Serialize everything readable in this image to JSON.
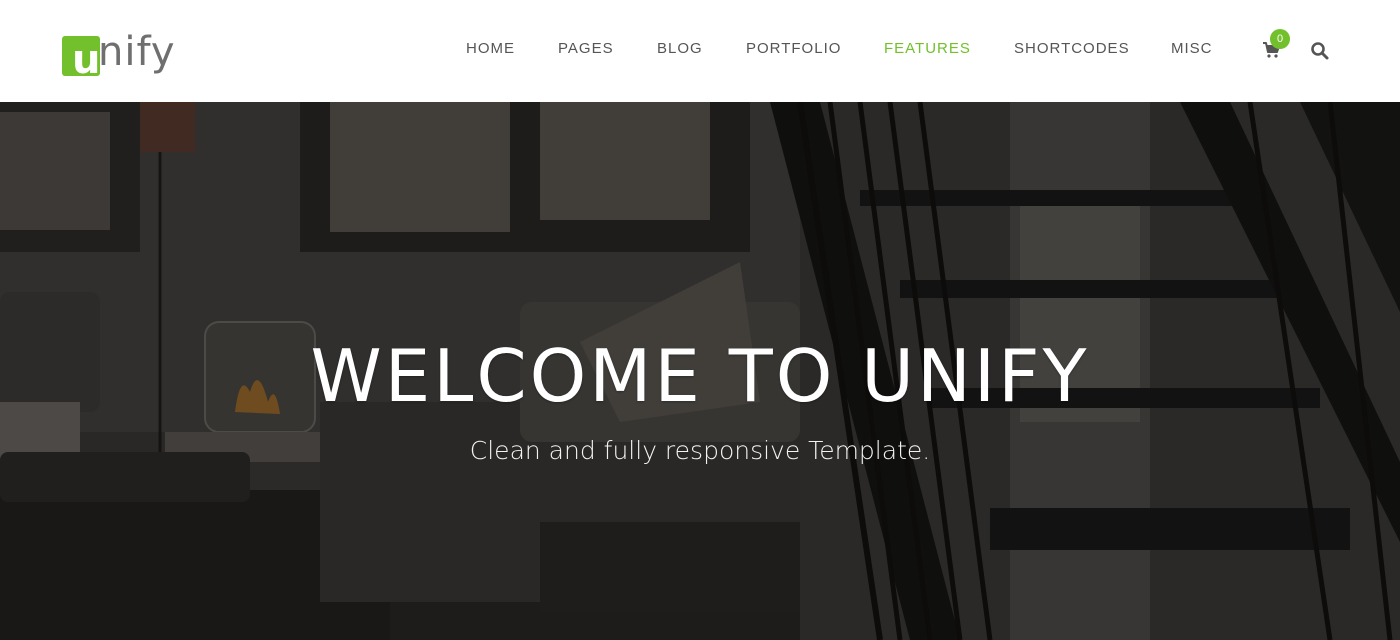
{
  "brand": {
    "logo_letter": "u",
    "logo_rest": "nify",
    "accent": "#72c02c"
  },
  "nav": {
    "items": [
      {
        "label": "HOME"
      },
      {
        "label": "PAGES"
      },
      {
        "label": "BLOG"
      },
      {
        "label": "PORTFOLIO"
      },
      {
        "label": "FEATURES",
        "active": true
      },
      {
        "label": "SHORTCODES"
      },
      {
        "label": "MISC"
      }
    ],
    "cart_count": "0",
    "cart_icon": "shopping-cart-icon",
    "search_icon": "search-icon"
  },
  "hero": {
    "title": "WELCOME TO UNIFY",
    "subtitle": "Clean and fully responsive Template."
  }
}
